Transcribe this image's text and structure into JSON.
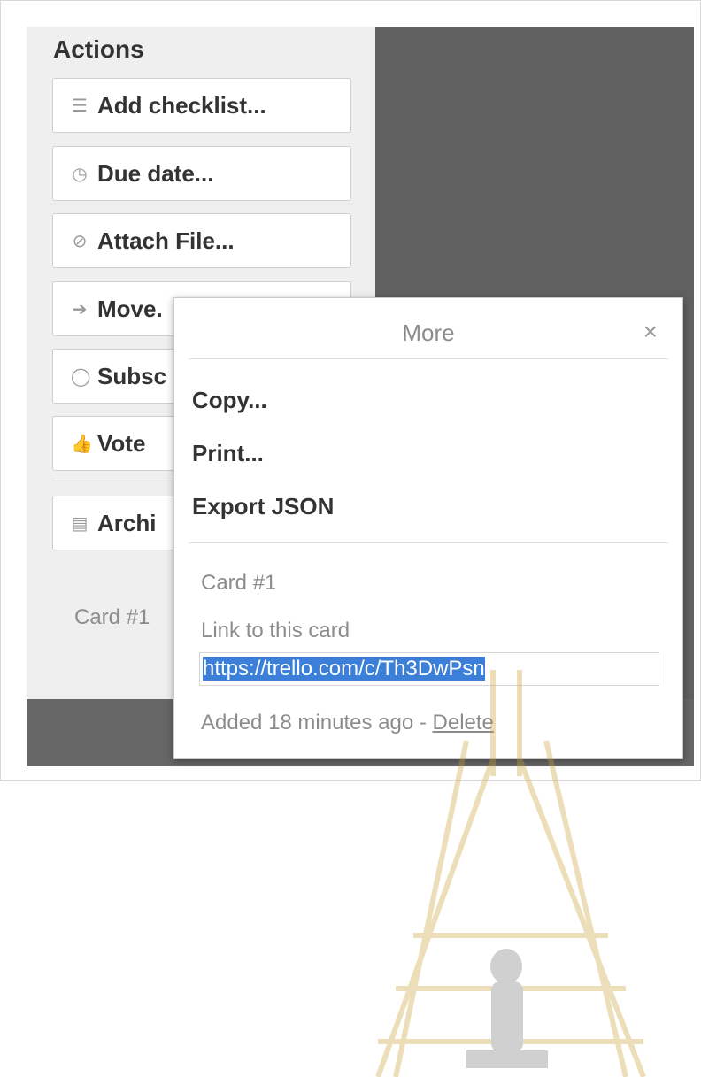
{
  "actions": {
    "title": "Actions",
    "buttons": [
      {
        "icon": "checklist-icon",
        "label": "Add checklist..."
      },
      {
        "icon": "clock-icon",
        "label": "Due date..."
      },
      {
        "icon": "paperclip-icon",
        "label": "Attach File..."
      },
      {
        "icon": "arrow-right-icon",
        "label": "Move."
      },
      {
        "icon": "eye-icon",
        "label": "Subsc"
      },
      {
        "icon": "thumbs-up-icon",
        "label": "Vote"
      },
      {
        "icon": "archive-icon",
        "label": "Archi"
      }
    ]
  },
  "card_label": "Card #1",
  "popup": {
    "title": "More",
    "close_glyph": "×",
    "items": [
      "Copy...",
      "Print...",
      "Export JSON"
    ],
    "card_name": "Card #1",
    "link_label": "Link to this card",
    "link_value": "https://trello.com/c/Th3DwPsn",
    "added_text": "Added 18 minutes ago - ",
    "delete_label": "Delete"
  },
  "colors": {
    "dark_background": "#606060",
    "selection": "#3b7fd8",
    "watermark": "#c9a23a"
  }
}
